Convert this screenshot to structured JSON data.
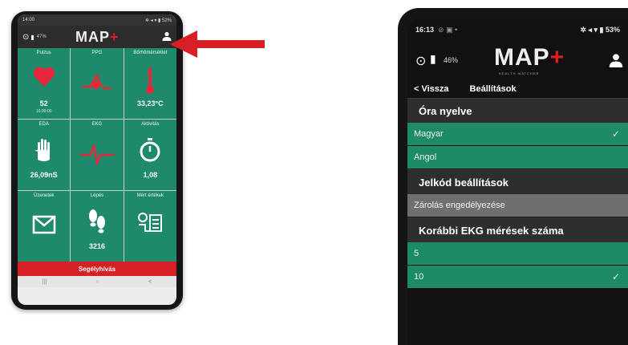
{
  "phone1": {
    "status": {
      "time": "14:00",
      "icons": "✲ ◂ ▾ ▮ 52%"
    },
    "header": {
      "battery": "47%",
      "logo_text": "MAP",
      "logo_plus": "+"
    },
    "tiles": [
      {
        "title": "Pulzus",
        "value": "52",
        "sub": "16:00:00",
        "icon": "heart-icon"
      },
      {
        "title": "PPG",
        "value": "",
        "sub": "",
        "icon": "ppg-wave-icon"
      },
      {
        "title": "Bőrhőmérséklet",
        "value": "33,23°C",
        "sub": "",
        "icon": "thermometer-icon"
      },
      {
        "title": "EDA",
        "value": "26,09nS",
        "sub": "",
        "icon": "hand-icon"
      },
      {
        "title": "EKG",
        "value": "",
        "sub": "",
        "icon": "ecg-wave-icon"
      },
      {
        "title": "Aktivitás",
        "value": "1,08",
        "sub": "",
        "icon": "stopwatch-icon"
      },
      {
        "title": "Üzenetek",
        "value": "",
        "sub": "",
        "icon": "envelope-icon"
      },
      {
        "title": "Lépés",
        "value": "3216",
        "sub": "",
        "icon": "footsteps-icon"
      },
      {
        "title": "Mért értékek",
        "value": "",
        "sub": "",
        "icon": "measured-values-icon"
      }
    ],
    "sos_label": "Segélyhívás",
    "navbar": [
      "|||",
      "○",
      "<"
    ]
  },
  "arrow_color": "#d71f26",
  "phone2": {
    "status": {
      "time": "16:13",
      "left_icons": "⊘ ▣ •",
      "right_icons": "✲ ◂ ▾ ▮ 53%"
    },
    "header": {
      "battery": "46%",
      "logo_text": "MAP",
      "logo_plus": "+",
      "tagline": "HEALTH WATCHER"
    },
    "nav": {
      "back_label": "< Vissza",
      "title": "Beállítások"
    },
    "sections": [
      {
        "heading": "Óra nyelve",
        "rows": [
          {
            "label": "Magyar",
            "checked": true,
            "style": "green"
          },
          {
            "label": "Angol",
            "checked": false,
            "style": "green"
          }
        ]
      },
      {
        "heading": "Jelkód beállítások",
        "rows": [
          {
            "label": "Zárolás engedélyezése",
            "checked": false,
            "style": "grey"
          }
        ]
      },
      {
        "heading": "Korábbi EKG mérések száma",
        "rows": [
          {
            "label": "5",
            "checked": false,
            "style": "green"
          },
          {
            "label": "10",
            "checked": true,
            "style": "green"
          }
        ]
      }
    ],
    "check_mark": "✓"
  },
  "colors": {
    "tile_green": "#1f8a6b",
    "row_green": "#1d8a68",
    "accent_red": "#d71f26"
  }
}
